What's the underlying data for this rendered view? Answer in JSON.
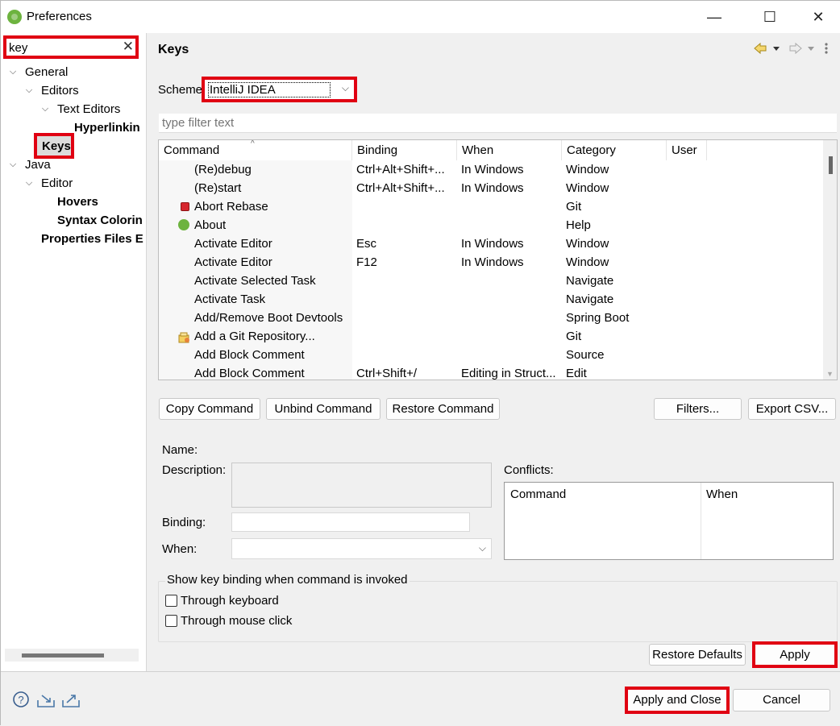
{
  "window": {
    "title": "Preferences",
    "controls": {
      "minimize": "—",
      "maximize": "☐",
      "close": "✕"
    }
  },
  "search": {
    "value": "key",
    "clear_glyph": "✕"
  },
  "tree": [
    {
      "label": "General",
      "level": 0,
      "arrow": "v",
      "bold": false
    },
    {
      "label": "Editors",
      "level": 1,
      "arrow": "v",
      "bold": false
    },
    {
      "label": "Text Editors",
      "level": 2,
      "arrow": "v",
      "bold": false
    },
    {
      "label": "Hyperlinkin",
      "level": 3,
      "arrow": "",
      "bold": true
    },
    {
      "label": "Keys",
      "level": 1,
      "arrow": "",
      "bold": true,
      "selected": true
    },
    {
      "label": "Java",
      "level": 0,
      "arrow": "v",
      "bold": false
    },
    {
      "label": "Editor",
      "level": 1,
      "arrow": "v",
      "bold": false
    },
    {
      "label": "Hovers",
      "level": 2,
      "arrow": "",
      "bold": true
    },
    {
      "label": "Syntax Colorin",
      "level": 2,
      "arrow": "",
      "bold": true
    },
    {
      "label": "Properties Files E",
      "level": 1,
      "arrow": "",
      "bold": true
    }
  ],
  "page": {
    "title": "Keys",
    "scheme_label": "Scheme:",
    "scheme_value": "IntelliJ IDEA",
    "filter_placeholder": "type filter text"
  },
  "table": {
    "columns": [
      "Command",
      "Binding",
      "When",
      "Category",
      "User"
    ],
    "rows": [
      {
        "icon": "",
        "command": "(Re)debug",
        "binding": "Ctrl+Alt+Shift+...",
        "when": "In Windows",
        "category": "Window"
      },
      {
        "icon": "",
        "command": "(Re)start",
        "binding": "Ctrl+Alt+Shift+...",
        "when": "In Windows",
        "category": "Window"
      },
      {
        "icon": "stop-icon",
        "command": "Abort Rebase",
        "binding": "",
        "when": "",
        "category": "Git"
      },
      {
        "icon": "spring-icon",
        "command": "About",
        "binding": "",
        "when": "",
        "category": "Help"
      },
      {
        "icon": "",
        "command": "Activate Editor",
        "binding": "Esc",
        "when": "In Windows",
        "category": "Window"
      },
      {
        "icon": "",
        "command": "Activate Editor",
        "binding": "F12",
        "when": "In Windows",
        "category": "Window"
      },
      {
        "icon": "",
        "command": "Activate Selected Task",
        "binding": "",
        "when": "",
        "category": "Navigate"
      },
      {
        "icon": "",
        "command": "Activate Task",
        "binding": "",
        "when": "",
        "category": "Navigate"
      },
      {
        "icon": "",
        "command": "Add/Remove Boot Devtools",
        "binding": "",
        "when": "",
        "category": "Spring Boot"
      },
      {
        "icon": "git-repo-icon",
        "command": "Add a Git Repository...",
        "binding": "",
        "when": "",
        "category": "Git"
      },
      {
        "icon": "",
        "command": "Add Block Comment",
        "binding": "",
        "when": "",
        "category": "Source"
      },
      {
        "icon": "",
        "command": "Add Block Comment",
        "binding": "Ctrl+Shift+/",
        "when": "Editing in Struct...",
        "category": "Edit"
      }
    ]
  },
  "buttons": {
    "copy_command": "Copy Command",
    "unbind_command": "Unbind Command",
    "restore_command": "Restore Command",
    "filters": "Filters...",
    "export_csv": "Export CSV...",
    "restore_defaults": "Restore Defaults",
    "apply": "Apply",
    "apply_and_close": "Apply and Close",
    "cancel": "Cancel"
  },
  "details": {
    "name_label": "Name:",
    "description_label": "Description:",
    "binding_label": "Binding:",
    "when_label": "When:",
    "conflicts_label": "Conflicts:",
    "conflicts_columns": [
      "Command",
      "When"
    ],
    "binding_value": "",
    "when_value": ""
  },
  "show_binding": {
    "title": "Show key binding when command is invoked",
    "through_keyboard": "Through keyboard",
    "through_mouse": "Through mouse click",
    "keyboard_checked": false,
    "mouse_checked": false
  },
  "colors": {
    "highlight": "#e00012",
    "spring_green": "#6db33f"
  }
}
